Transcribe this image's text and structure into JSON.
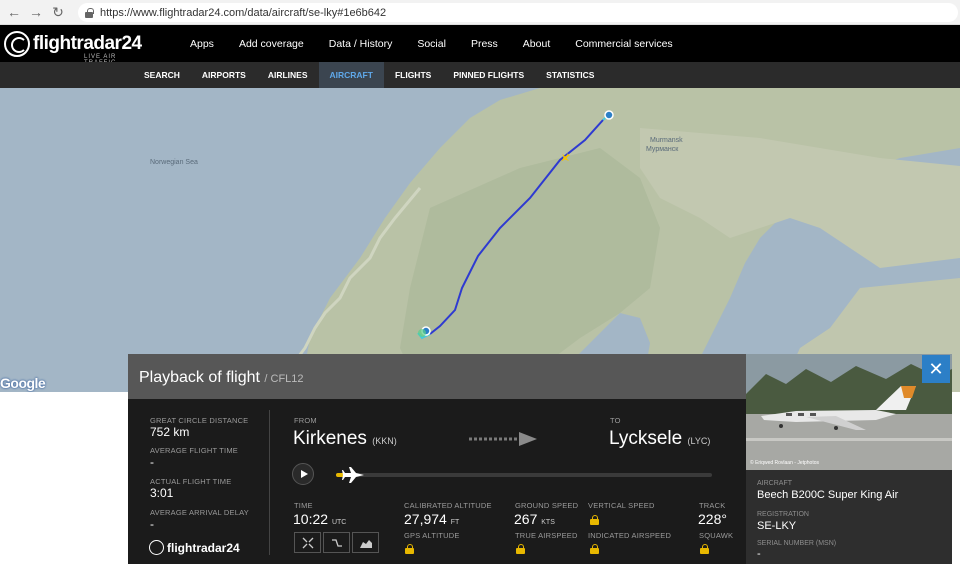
{
  "browser": {
    "url": "https://www.flightradar24.com/data/aircraft/se-lky#1e6b642",
    "back": "←",
    "forward": "→",
    "reload": "↻"
  },
  "brand": {
    "name": "flightradar24",
    "tagline": "LIVE AIR TRAFFIC"
  },
  "topnav": [
    "Apps",
    "Add coverage",
    "Data / History",
    "Social",
    "Press",
    "About",
    "Commercial services"
  ],
  "subnav": {
    "items": [
      "SEARCH",
      "AIRPORTS",
      "AIRLINES",
      "AIRCRAFT",
      "FLIGHTS",
      "PINNED FLIGHTS",
      "STATISTICS"
    ],
    "active_index": 3
  },
  "map": {
    "labels": {
      "sea": "Norwegian Sea",
      "murmansk": "Murmansk",
      "murmansk_ru": "Мурманск"
    },
    "google": "Google",
    "route_color": "#2e3ad1",
    "water_color": "#a3b6c6",
    "land_color": "#b9c2a6"
  },
  "playback": {
    "title": "Playback of flight",
    "flight": "/ CFL12",
    "stats": {
      "gcd_label": "GREAT CIRCLE DISTANCE",
      "gcd_value": "752 km",
      "avg_time_label": "AVERAGE FLIGHT TIME",
      "avg_time_value": "-",
      "actual_time_label": "ACTUAL FLIGHT TIME",
      "actual_time_value": "3:01",
      "delay_label": "AVERAGE ARRIVAL DELAY",
      "delay_value": "-"
    },
    "from_label": "FROM",
    "from_city": "Kirkenes",
    "from_code": "(KKN)",
    "to_label": "TO",
    "to_city": "Lycksele",
    "to_code": "(LYC)",
    "progress": 0.05,
    "metrics": {
      "time_label": "TIME",
      "time_value": "10:22",
      "time_unit": "UTC",
      "calt_label": "CALIBRATED ALTITUDE",
      "calt_value": "27,974",
      "calt_unit": "FT",
      "gps_label": "GPS ALTITUDE",
      "gs_label": "GROUND SPEED",
      "gs_value": "267",
      "gs_unit": "KTS",
      "tas_label": "TRUE AIRSPEED",
      "vs_label": "VERTICAL SPEED",
      "ias_label": "INDICATED AIRSPEED",
      "track_label": "TRACK",
      "track_value": "228°",
      "squawk_label": "SQUAWK"
    },
    "footer_logo": "flightradar24"
  },
  "aircraft": {
    "photo_credit": "© Eriqwed Rovlaan - Jetphotos",
    "aircraft_label": "AIRCRAFT",
    "aircraft_value": "Beech B200C Super King Air",
    "reg_label": "REGISTRATION",
    "reg_value": "SE-LKY",
    "serial_label": "SERIAL NUMBER (MSN)",
    "serial_value": "-",
    "close": "✕"
  }
}
